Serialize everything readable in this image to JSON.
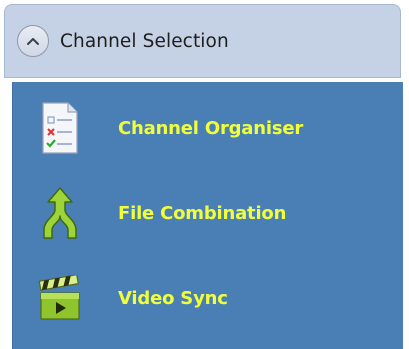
{
  "header": {
    "title": "Channel Selection",
    "collapse_icon": "chevron-up-icon",
    "background": "#c5d1e5"
  },
  "items": [
    {
      "label": "Channel Organiser",
      "icon": "checklist-icon"
    },
    {
      "label": "File Combination",
      "icon": "merge-arrow-icon"
    },
    {
      "label": "Video Sync",
      "icon": "clapperboard-icon"
    }
  ],
  "colors": {
    "panel_background": "#4a7fb5",
    "item_text": "#f0ff3a"
  }
}
